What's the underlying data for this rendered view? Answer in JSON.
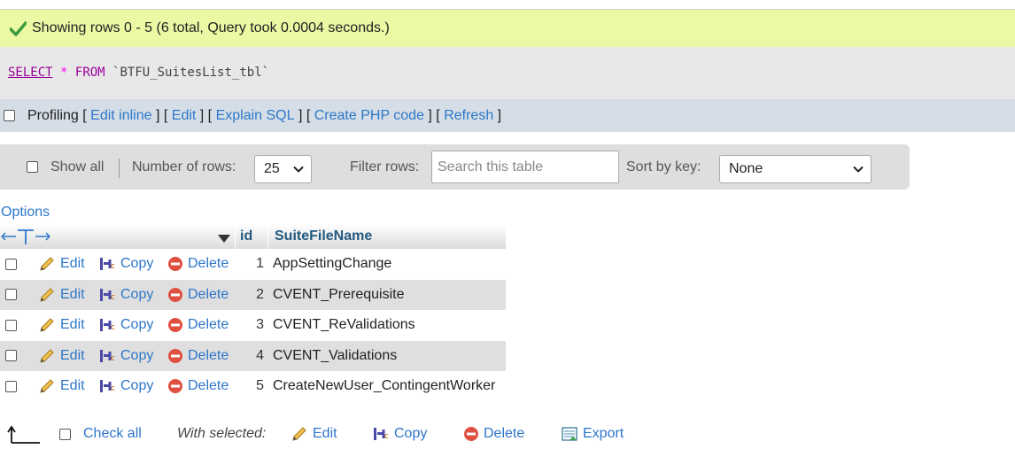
{
  "success": {
    "message": "Showing rows 0 - 5 (6 total, Query took 0.0004 seconds.)",
    "icon": "check-icon"
  },
  "sql": {
    "select": "SELECT",
    "star": "*",
    "from": "FROM",
    "table": "`BTFU_SuitesList_tbl`"
  },
  "links": {
    "profiling": "Profiling",
    "edit_inline": "Edit inline",
    "edit": "Edit",
    "explain_sql": "Explain SQL",
    "create_php": "Create PHP code",
    "refresh": "Refresh"
  },
  "nav": {
    "show_all": "Show all",
    "num_rows_label": "Number of rows:",
    "num_rows_value": "25",
    "filter_label": "Filter rows:",
    "search_placeholder": "Search this table",
    "sort_label": "Sort by key:",
    "sort_value": "None"
  },
  "options_label": "Options",
  "table": {
    "columns": [
      "id",
      "SuiteFileName"
    ],
    "rows": [
      {
        "id": "1",
        "name": "AppSettingChange"
      },
      {
        "id": "2",
        "name": "CVENT_Prerequisite"
      },
      {
        "id": "3",
        "name": "CVENT_ReValidations"
      },
      {
        "id": "4",
        "name": "CVENT_Validations"
      },
      {
        "id": "5",
        "name": "CreateNewUser_ContingentWorker"
      }
    ],
    "actions": {
      "edit": "Edit",
      "copy": "Copy",
      "delete": "Delete"
    }
  },
  "footer": {
    "check_all": "Check all",
    "with_selected": "With selected:",
    "edit": "Edit",
    "copy": "Copy",
    "delete": "Delete",
    "export": "Export"
  },
  "colors": {
    "success_bg": "#ebf8a4",
    "link": "#2d76c9",
    "header_text": "#235a81",
    "sql_keyword": "#990099"
  }
}
